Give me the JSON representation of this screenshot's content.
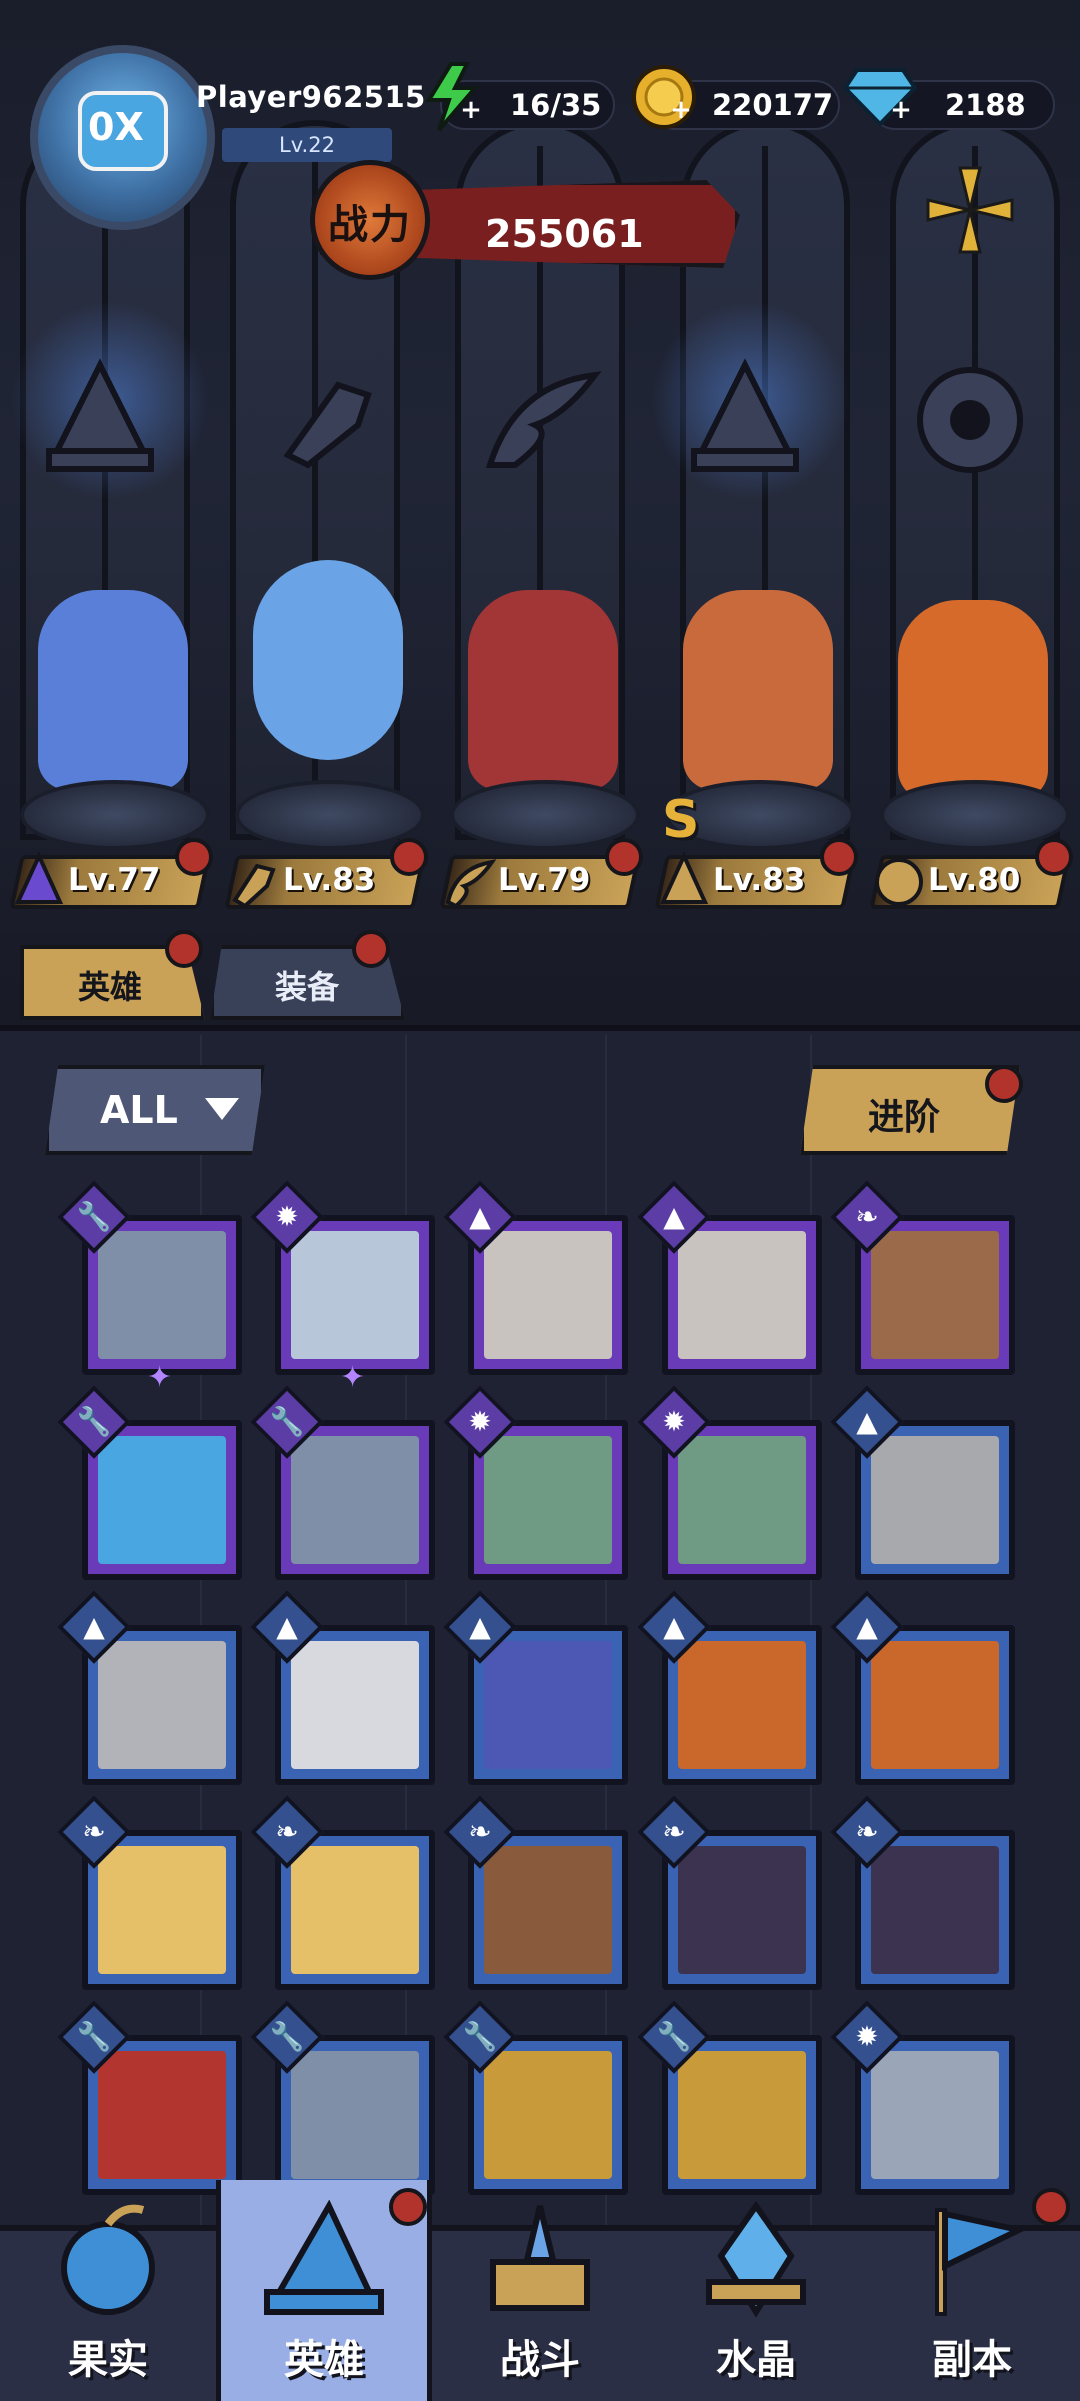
{
  "player": {
    "name": "Player962515",
    "level": "Lv.22",
    "avatar_text": "0X"
  },
  "resources": {
    "energy": "16/35",
    "gold": "220177",
    "gems": "2188"
  },
  "power": {
    "label": "战力",
    "value": "255061"
  },
  "heroes_on_stage": [
    {
      "level": "Lv.77",
      "class": "mage",
      "color": "#5a7fd8"
    },
    {
      "level": "Lv.83",
      "class": "warrior",
      "color": "#6aa4e6"
    },
    {
      "level": "Lv.79",
      "class": "rogue",
      "color": "#a23636"
    },
    {
      "level": "Lv.83",
      "class": "mage",
      "color": "#c96a3c"
    },
    {
      "level": "Lv.80",
      "class": "beast",
      "color": "#d56a2a"
    }
  ],
  "hero_rank_badge": "S",
  "tabs": {
    "heroes": "英雄",
    "equipment": "装备"
  },
  "filter": {
    "label": "ALL"
  },
  "advance_button": "进阶",
  "hero_cards": [
    {
      "class": "warrior",
      "rarity": "epic",
      "color": "#7f8fa8",
      "stars": 1
    },
    {
      "class": "beast",
      "rarity": "epic",
      "color": "#b7c7d9",
      "stars": 1
    },
    {
      "class": "mage",
      "rarity": "epic",
      "color": "#c9c3c0",
      "stars": 0
    },
    {
      "class": "mage",
      "rarity": "epic",
      "color": "#c9c3c0",
      "stars": 0
    },
    {
      "class": "rogue",
      "rarity": "epic",
      "color": "#9a6a4a",
      "stars": 0
    },
    {
      "class": "warrior",
      "rarity": "epic",
      "color": "#4aa6e0",
      "stars": 0
    },
    {
      "class": "warrior",
      "rarity": "epic",
      "color": "#7f8fa8",
      "stars": 0
    },
    {
      "class": "beast",
      "rarity": "epic",
      "color": "#6f9a84",
      "stars": 0
    },
    {
      "class": "beast",
      "rarity": "epic",
      "color": "#6f9a84",
      "stars": 0
    },
    {
      "class": "mage",
      "rarity": "rare",
      "color": "#a8a9ad",
      "stars": 0
    },
    {
      "class": "mage",
      "rarity": "rare",
      "color": "#b2b3b8",
      "stars": 0
    },
    {
      "class": "mage",
      "rarity": "rare",
      "color": "#d8d8df",
      "stars": 0
    },
    {
      "class": "mage",
      "rarity": "rare",
      "color": "#4d57b4",
      "stars": 0
    },
    {
      "class": "mage",
      "rarity": "rare",
      "color": "#c9682a",
      "stars": 0
    },
    {
      "class": "mage",
      "rarity": "rare",
      "color": "#c9682a",
      "stars": 0
    },
    {
      "class": "rogue",
      "rarity": "rare",
      "color": "#e6c068",
      "stars": 0
    },
    {
      "class": "rogue",
      "rarity": "rare",
      "color": "#e6c068",
      "stars": 0
    },
    {
      "class": "rogue",
      "rarity": "rare",
      "color": "#8a5a3c",
      "stars": 0
    },
    {
      "class": "rogue",
      "rarity": "rare",
      "color": "#3b3350",
      "stars": 0
    },
    {
      "class": "rogue",
      "rarity": "rare",
      "color": "#3b3350",
      "stars": 0
    },
    {
      "class": "warrior",
      "rarity": "rare",
      "color": "#b3352f",
      "stars": 0
    },
    {
      "class": "warrior",
      "rarity": "rare",
      "color": "#7f8fa8",
      "stars": 0
    },
    {
      "class": "warrior",
      "rarity": "rare",
      "color": "#c89a3a",
      "stars": 0
    },
    {
      "class": "warrior",
      "rarity": "rare",
      "color": "#c89a3a",
      "stars": 0
    },
    {
      "class": "beast",
      "rarity": "rare",
      "color": "#9aa6b8",
      "stars": 0
    }
  ],
  "class_glyphs": {
    "warrior": "🔧",
    "beast": "✹",
    "mage": "▲",
    "rogue": "❧"
  },
  "bottom_nav": [
    {
      "label": "果实",
      "icon": "fruit-icon",
      "active": false,
      "badge": false
    },
    {
      "label": "英雄",
      "icon": "wizard-hat-icon",
      "active": true,
      "badge": true
    },
    {
      "label": "战斗",
      "icon": "sword-book-icon",
      "active": false,
      "badge": false
    },
    {
      "label": "水晶",
      "icon": "crystal-icon",
      "active": false,
      "badge": false
    },
    {
      "label": "副本",
      "icon": "flag-icon",
      "active": false,
      "badge": true
    }
  ],
  "colors": {
    "epic": "#6a3bb8",
    "rare": "#3a63b4",
    "gold_accent": "#c9a257",
    "badge_red": "#b2332b",
    "power_red": "#7a1f1f"
  }
}
